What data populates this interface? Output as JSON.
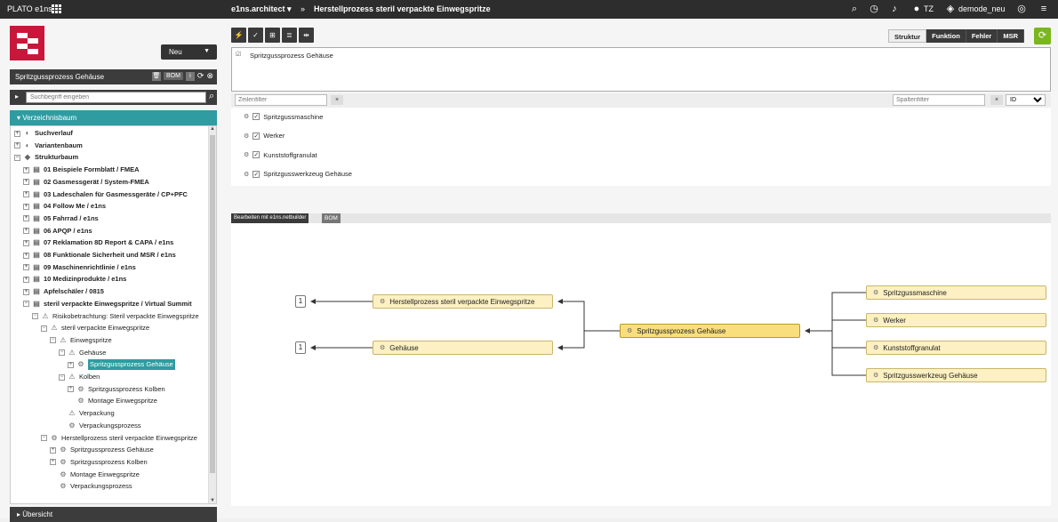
{
  "topbar": {
    "brand": "PLATO e1ns",
    "app_menu": "e1ns.architect ▾",
    "crumb_sep": "»",
    "crumb": "Herstellprozess steril verpackte Einwegspritze",
    "user": "TZ",
    "db": "demode_neu"
  },
  "left": {
    "new_button": "Neu",
    "panel_title": "Spritzgussprozess Gehäuse",
    "panel_tag": "BOM",
    "search_placeholder": "Suchbegriff eingeben",
    "tree_title": "Verzeichnisbaum",
    "footer": "Übersicht",
    "tree": [
      {
        "label": "Suchverlauf",
        "level": 0,
        "pm": "+",
        "icon": "◐",
        "bold": true
      },
      {
        "label": "Variantenbaum",
        "level": 0,
        "pm": "+",
        "icon": "◐",
        "bold": true
      },
      {
        "label": "Strukturbaum",
        "level": 0,
        "pm": "−",
        "icon": "◆",
        "bold": true
      },
      {
        "label": "01 Beispiele Formblatt / FMEA",
        "level": 1,
        "pm": "+",
        "icon": "▤",
        "bold": true
      },
      {
        "label": "02 Gasmessgerät / System-FMEA",
        "level": 1,
        "pm": "+",
        "icon": "▤",
        "bold": true
      },
      {
        "label": "03 Ladeschalen für Gasmessgeräte / CP+PFC",
        "level": 1,
        "pm": "+",
        "icon": "▤",
        "bold": true
      },
      {
        "label": "04 Follow Me / e1ns",
        "level": 1,
        "pm": "+",
        "icon": "▤",
        "bold": true
      },
      {
        "label": "05 Fahrrad / e1ns",
        "level": 1,
        "pm": "+",
        "icon": "▤",
        "bold": true
      },
      {
        "label": "06 APQP / e1ns",
        "level": 1,
        "pm": "+",
        "icon": "▤",
        "bold": true
      },
      {
        "label": "07 Reklamation 8D Report & CAPA / e1ns",
        "level": 1,
        "pm": "+",
        "icon": "▤",
        "bold": true
      },
      {
        "label": "08 Funktionale Sicherheit und MSR / e1ns",
        "level": 1,
        "pm": "+",
        "icon": "▤",
        "bold": true
      },
      {
        "label": "09 Maschinenrichtlinie / e1ns",
        "level": 1,
        "pm": "+",
        "icon": "▤",
        "bold": true
      },
      {
        "label": "10 Medizinprodukte / e1ns",
        "level": 1,
        "pm": "+",
        "icon": "▤",
        "bold": true
      },
      {
        "label": "Apfelschäler / 0815",
        "level": 1,
        "pm": "+",
        "icon": "▤",
        "bold": true
      },
      {
        "label": "steril verpackte Einwegspritze / Virtual Summit",
        "level": 1,
        "pm": "−",
        "icon": "▤",
        "bold": true
      },
      {
        "label": "Risikobetrachtung: Steril verpackte Einwegspritze",
        "level": 2,
        "pm": "−",
        "icon": "⚠",
        "bold": false
      },
      {
        "label": "steril verpackte Einwegspritze",
        "level": 3,
        "pm": "−",
        "icon": "⚠",
        "bold": false
      },
      {
        "label": "Einwegspritze",
        "level": 4,
        "pm": "−",
        "icon": "⚠",
        "bold": false
      },
      {
        "label": "Gehäuse",
        "level": 5,
        "pm": "−",
        "icon": "⚠",
        "bold": false
      },
      {
        "label": "Spritzgussprozess Gehäuse",
        "level": 6,
        "pm": "+",
        "icon": "⚙",
        "bold": false,
        "selected": true
      },
      {
        "label": "Kolben",
        "level": 5,
        "pm": "−",
        "icon": "⚠",
        "bold": false
      },
      {
        "label": "Spritzgussprozess Kolben",
        "level": 6,
        "pm": "+",
        "icon": "⚙",
        "bold": false
      },
      {
        "label": "Montage Einwegspritze",
        "level": 6,
        "pm": "",
        "icon": "⚙",
        "bold": false
      },
      {
        "label": "Verpackung",
        "level": 5,
        "pm": "",
        "icon": "⚠",
        "bold": false
      },
      {
        "label": "Verpackungsprozess",
        "level": 5,
        "pm": "",
        "icon": "⚙",
        "bold": false
      },
      {
        "label": "Herstellprozess steril verpackte Einwegspritze",
        "level": 3,
        "pm": "−",
        "icon": "⚙",
        "bold": false
      },
      {
        "label": "Spritzgussprozess Gehäuse",
        "level": 4,
        "pm": "+",
        "icon": "⚙",
        "bold": false
      },
      {
        "label": "Spritzgussprozess Kolben",
        "level": 4,
        "pm": "+",
        "icon": "⚙",
        "bold": false
      },
      {
        "label": "Montage Einwegspritze",
        "level": 4,
        "pm": "",
        "icon": "⚙",
        "bold": false
      },
      {
        "label": "Verpackungsprozess",
        "level": 4,
        "pm": "",
        "icon": "⚙",
        "bold": false
      }
    ]
  },
  "main": {
    "view_tabs": [
      "Struktur",
      "Funktion",
      "Fehler",
      "MSR"
    ],
    "active_tab": "Struktur",
    "editbox_text": "Spritzgussprozess Gehäuse",
    "row_filter_placeholder": "Zeilenfilter",
    "col_filter_placeholder": "Spaltenfilter",
    "id_select": "ID",
    "clear_x": "×",
    "func_items": [
      "Spritzgussmaschine",
      "Werker",
      "Kunststoffgranulat",
      "Spritzgusswerkzeug Gehäuse"
    ],
    "net_tag1": "Bearbeiten mit e1ns.netbuilder",
    "net_tag2": "BOM",
    "graph": {
      "center": "Spritzgussprozess Gehäuse",
      "left_nodes": [
        "Herstellprozess steril verpackte Einwegspritze",
        "Gehäuse"
      ],
      "left_counts": [
        "1",
        "1"
      ],
      "right_nodes": [
        "Spritzgussmaschine",
        "Werker",
        "Kunststoffgranulat",
        "Spritzgusswerkzeug Gehäuse"
      ]
    }
  }
}
